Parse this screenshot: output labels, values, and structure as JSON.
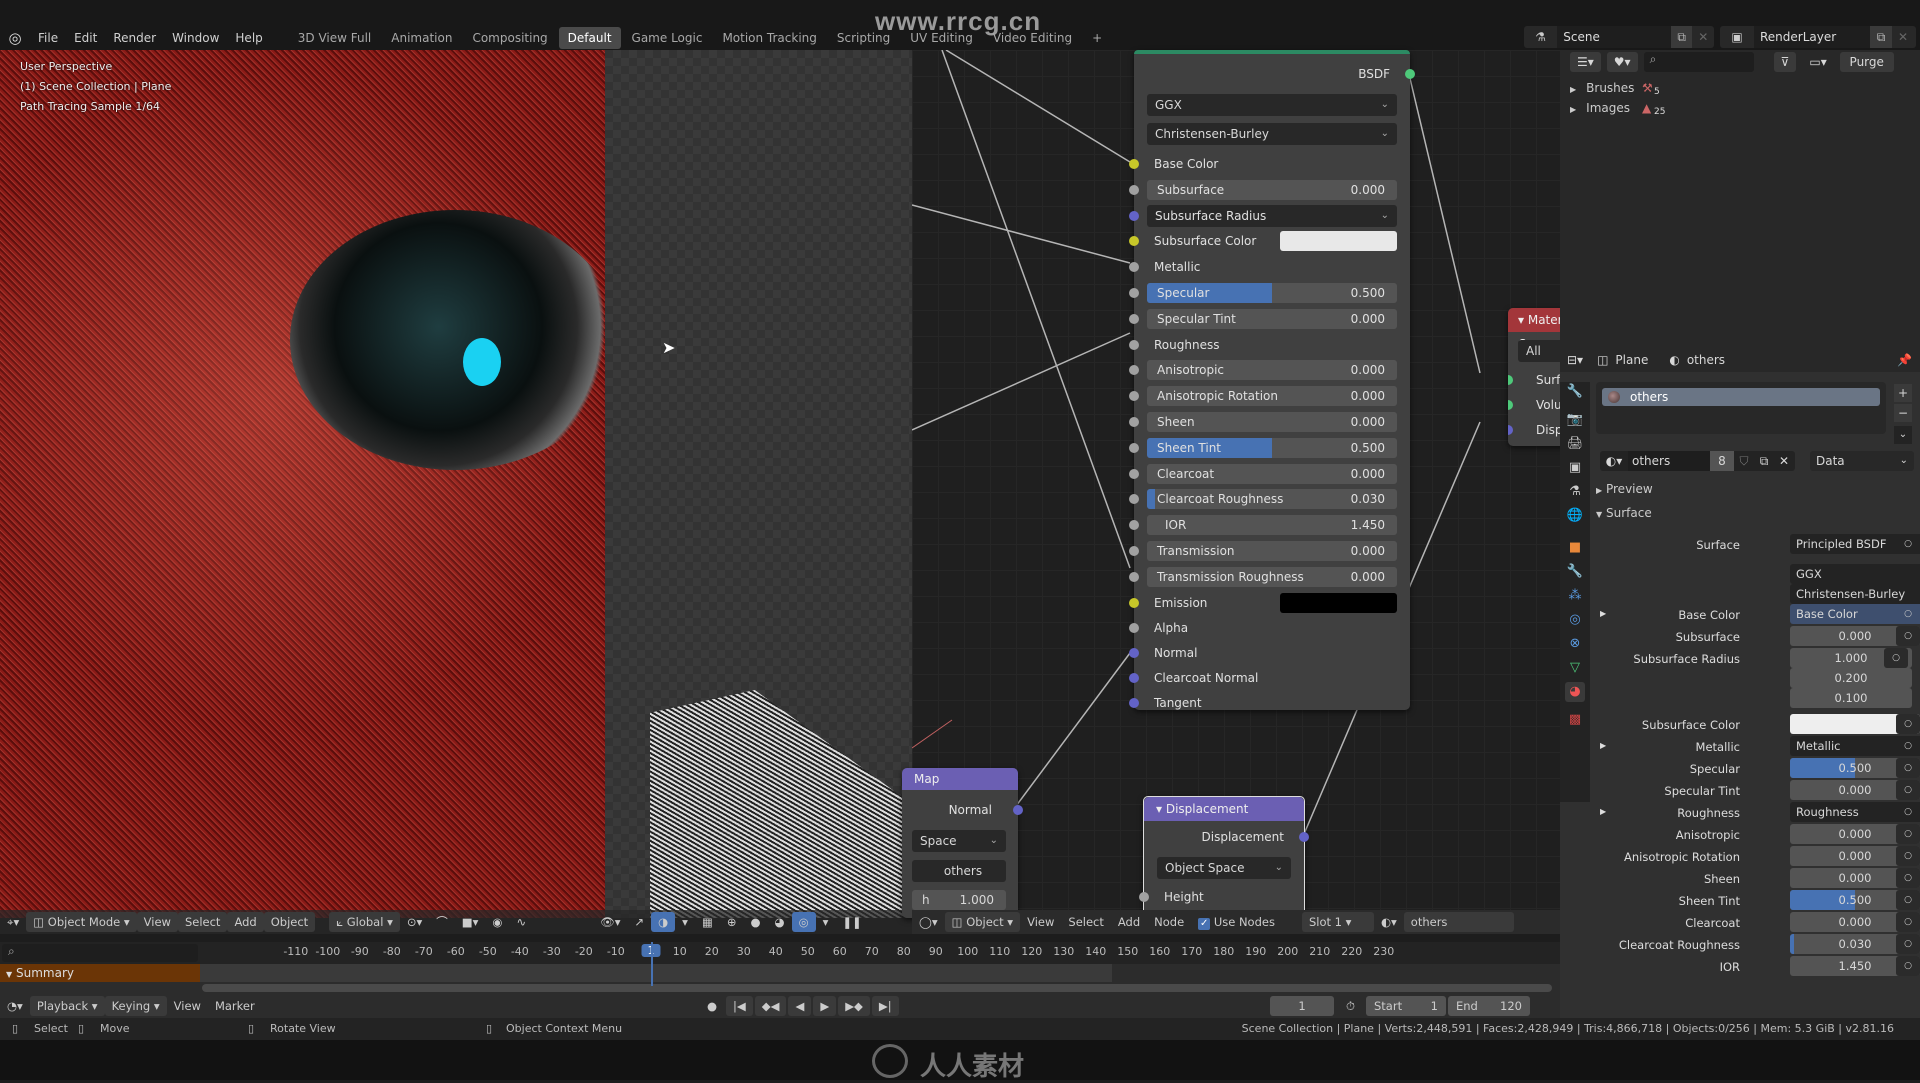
{
  "app": {
    "menu": [
      "File",
      "Edit",
      "Render",
      "Window",
      "Help"
    ],
    "workspaces": [
      "3D View Full",
      "Animation",
      "Compositing",
      "Default",
      "Game Logic",
      "Motion Tracking",
      "Scripting",
      "UV Editing",
      "Video Editing"
    ],
    "active_workspace": "Default",
    "add_workspace": "+",
    "watermark": "www.rrcg.cn",
    "scene": "Scene",
    "view_layer": "RenderLayer"
  },
  "viewport": {
    "info": [
      "User Perspective",
      "(1) Scene Collection | Plane",
      "Path Tracing Sample 1/64"
    ],
    "header": {
      "mode": "Object Mode",
      "menus": [
        "View",
        "Select",
        "Add",
        "Object"
      ],
      "orientation": "Global"
    }
  },
  "node_editor": {
    "header": {
      "object": "Object",
      "menus": [
        "View",
        "Select",
        "Add",
        "Node"
      ],
      "use_nodes_label": "Use Nodes",
      "use_nodes": true,
      "slot": "Slot 1",
      "material": "others"
    },
    "bsdf": {
      "output": "BSDF",
      "distribution": "GGX",
      "subsurface_method": "Christensen-Burley",
      "inputs": [
        {
          "label": "Base Color",
          "type": "socket",
          "socket": "#c7c729"
        },
        {
          "label": "Subsurface",
          "type": "value",
          "value": "0.000",
          "fraction": 0,
          "socket": "#a1a1a1"
        },
        {
          "label": "Subsurface Radius",
          "type": "dropdown",
          "socket": "#6363c7"
        },
        {
          "label": "Subsurface Color",
          "type": "color",
          "color": "#e8e8e8",
          "socket": "#c7c729"
        },
        {
          "label": "Metallic",
          "type": "socket",
          "socket": "#a1a1a1"
        },
        {
          "label": "Specular",
          "type": "value",
          "value": "0.500",
          "fraction": 0.5,
          "socket": "#a1a1a1"
        },
        {
          "label": "Specular Tint",
          "type": "value",
          "value": "0.000",
          "fraction": 0,
          "socket": "#a1a1a1"
        },
        {
          "label": "Roughness",
          "type": "socket",
          "socket": "#a1a1a1"
        },
        {
          "label": "Anisotropic",
          "type": "value",
          "value": "0.000",
          "fraction": 0,
          "socket": "#a1a1a1"
        },
        {
          "label": "Anisotropic Rotation",
          "type": "value",
          "value": "0.000",
          "fraction": 0,
          "socket": "#a1a1a1"
        },
        {
          "label": "Sheen",
          "type": "value",
          "value": "0.000",
          "fraction": 0,
          "socket": "#a1a1a1"
        },
        {
          "label": "Sheen Tint",
          "type": "value",
          "value": "0.500",
          "fraction": 0.5,
          "socket": "#a1a1a1"
        },
        {
          "label": "Clearcoat",
          "type": "value",
          "value": "0.000",
          "fraction": 0,
          "socket": "#a1a1a1"
        },
        {
          "label": "Clearcoat Roughness",
          "type": "value",
          "value": "0.030",
          "fraction": 0.03,
          "socket": "#a1a1a1"
        },
        {
          "label": "IOR",
          "type": "value",
          "value": "1.450",
          "fraction": 0,
          "socket": "#a1a1a1"
        },
        {
          "label": "Transmission",
          "type": "value",
          "value": "0.000",
          "fraction": 0,
          "socket": "#a1a1a1"
        },
        {
          "label": "Transmission Roughness",
          "type": "value",
          "value": "0.000",
          "fraction": 0,
          "socket": "#a1a1a1"
        },
        {
          "label": "Emission",
          "type": "color",
          "color": "#000000",
          "socket": "#c7c729"
        },
        {
          "label": "Alpha",
          "type": "socket",
          "socket": "#a1a1a1"
        },
        {
          "label": "Normal",
          "type": "socket",
          "socket": "#6363c7"
        },
        {
          "label": "Clearcoat Normal",
          "type": "socket",
          "socket": "#6363c7"
        },
        {
          "label": "Tangent",
          "type": "socket",
          "socket": "#6363c7"
        }
      ]
    },
    "material_output": {
      "title": "Material O",
      "target": "All",
      "inputs": [
        "Surface",
        "Volume",
        "Displacem"
      ]
    },
    "normal_map": {
      "title": "Map",
      "output": "Normal",
      "space": "Space",
      "uv": "others",
      "strength_label": "h",
      "strength": "1.000"
    },
    "displacement": {
      "title": "Displacement",
      "output": "Displacement",
      "space": "Object Space",
      "input": "Height"
    }
  },
  "outliner": {
    "purge_label": "Purge",
    "items": [
      {
        "label": "Brushes",
        "count": "5"
      },
      {
        "label": "Images",
        "count": "25"
      }
    ]
  },
  "properties": {
    "header": {
      "object": "Plane",
      "material": "others"
    },
    "slots": [
      "others"
    ],
    "material_name": "others",
    "users": "8",
    "link": "Data",
    "panels": {
      "preview": "Preview",
      "surface": "Surface"
    },
    "rows": [
      {
        "label": "Surface",
        "kind": "link",
        "value": "Principled BSDF"
      },
      {
        "label": "",
        "kind": "dropdown",
        "value": "GGX"
      },
      {
        "label": "",
        "kind": "dropdown",
        "value": "Christensen-Burley"
      },
      {
        "label": "Base Color",
        "kind": "link",
        "value": "Base Color",
        "expand": true,
        "highlight": true
      },
      {
        "label": "Subsurface",
        "kind": "value",
        "value": "0.000",
        "fraction": 0
      },
      {
        "label": "Subsurface Radius",
        "kind": "vector",
        "values": [
          "1.000",
          "0.200",
          "0.100"
        ]
      },
      {
        "label": "Subsurface Color",
        "kind": "color",
        "color": "#eeeeee"
      },
      {
        "label": "Metallic",
        "kind": "link",
        "value": "Metallic",
        "expand": true
      },
      {
        "label": "Specular",
        "kind": "value",
        "value": "0.500",
        "fraction": 0.5
      },
      {
        "label": "Specular Tint",
        "kind": "value",
        "value": "0.000",
        "fraction": 0
      },
      {
        "label": "Roughness",
        "kind": "link",
        "value": "Roughness",
        "expand": true
      },
      {
        "label": "Anisotropic",
        "kind": "value",
        "value": "0.000",
        "fraction": 0
      },
      {
        "label": "Anisotropic Rotation",
        "kind": "value",
        "value": "0.000",
        "fraction": 0
      },
      {
        "label": "Sheen",
        "kind": "value",
        "value": "0.000",
        "fraction": 0
      },
      {
        "label": "Sheen Tint",
        "kind": "value",
        "value": "0.500",
        "fraction": 0.5
      },
      {
        "label": "Clearcoat",
        "kind": "value",
        "value": "0.000",
        "fraction": 0
      },
      {
        "label": "Clearcoat Roughness",
        "kind": "value",
        "value": "0.030",
        "fraction": 0.03
      },
      {
        "label": "IOR",
        "kind": "value",
        "value": "1.450",
        "fraction": 0
      }
    ]
  },
  "timeline": {
    "summary_label": "Summary",
    "ticks": [
      "-110",
      "-100",
      "-90",
      "-80",
      "-70",
      "-60",
      "-50",
      "-40",
      "-30",
      "-20",
      "-10",
      "1",
      "10",
      "20",
      "30",
      "40",
      "50",
      "60",
      "70",
      "80",
      "90",
      "100",
      "110",
      "120",
      "130",
      "140",
      "150",
      "160",
      "170",
      "180",
      "190",
      "200",
      "210",
      "220",
      "230"
    ],
    "current_frame": "1",
    "menus": [
      "Playback",
      "Keying",
      "View",
      "Marker"
    ],
    "frame": "1",
    "start_label": "Start",
    "start": "1",
    "end_label": "End",
    "end": "120"
  },
  "statusbar": {
    "hints": [
      "Select",
      "Move",
      "Rotate View",
      "Object Context Menu"
    ],
    "stats": "Scene Collection | Plane | Verts:2,448,591 | Faces:2,428,949 | Tris:4,866,718 | Objects:0/256 | Mem: 5.3 GiB | v2.81.16"
  },
  "bottom_watermark": "人人素材"
}
